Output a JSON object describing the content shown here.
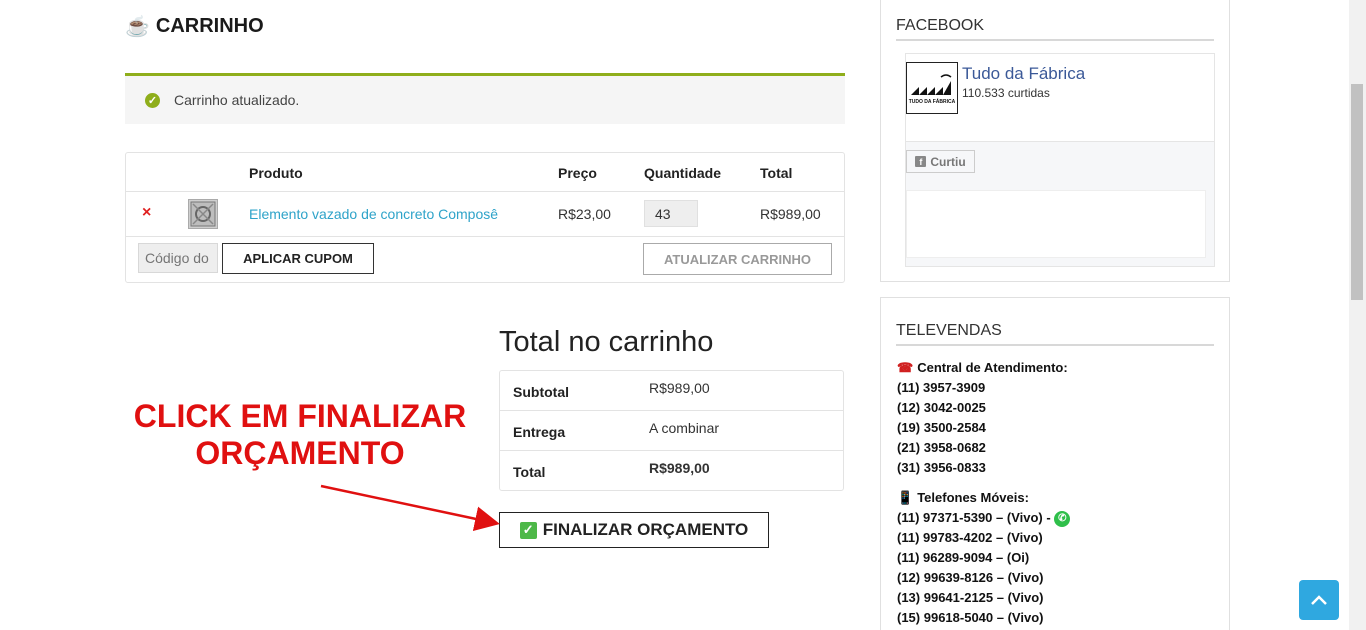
{
  "cart": {
    "title": "CARRINHO",
    "cup_icon": "coffee-cup-icon",
    "notice": "Carrinho atualizado.",
    "headers": {
      "product": "Produto",
      "price": "Preço",
      "quantity": "Quantidade",
      "total": "Total"
    },
    "items": [
      {
        "remove": "×",
        "name": "Elemento vazado de concreto Composê",
        "price": "R$23,00",
        "quantity": "43",
        "total": "R$989,00"
      }
    ],
    "coupon_placeholder": "Código do",
    "apply_coupon": "APLICAR CUPOM",
    "update_cart": "ATUALIZAR CARRINHO"
  },
  "totals": {
    "title": "Total no carrinho",
    "rows": [
      {
        "label": "Subtotal",
        "value": "R$989,00"
      },
      {
        "label": "Entrega",
        "value": "A combinar"
      },
      {
        "label": "Total",
        "value": "R$989,00"
      }
    ],
    "checkout": "FINALIZAR ORÇAMENTO"
  },
  "annotation": {
    "line1": "CLICK EM FINALIZAR",
    "line2": "ORÇAMENTO",
    "color": "#e01010"
  },
  "sidebar": {
    "facebook": {
      "title": "FACEBOOK",
      "page_name": "Tudo da Fábrica",
      "likes": "110.533 curtidas",
      "like_button": "Curtiu",
      "logo_text": "TUDO DA FÁBRICA"
    },
    "televendas": {
      "title": "TELEVENDAS",
      "central_label": "Central de Atendimento:",
      "central_phones": [
        "(11) 3957-3909",
        "(12) 3042-0025",
        "(19) 3500-2584",
        "(21) 3958-0682",
        "(31) 3956-0833"
      ],
      "mobile_label": "Telefones Móveis:",
      "mobile_phones": [
        "(11) 97371-5390 – (Vivo) -",
        "(11) 99783-4202 – (Vivo)",
        "(11) 96289-9094 – (Oi)",
        "(12) 99639-8126 – (Vivo)",
        "(13) 99641-2125 – (Vivo)",
        "(15) 99618-5040 – (Vivo)"
      ]
    }
  },
  "colors": {
    "accent_green": "#8fae1b",
    "link_blue": "#2ea3c9",
    "facebook_blue": "#3b5998",
    "back_to_top": "#2fa8e0"
  }
}
